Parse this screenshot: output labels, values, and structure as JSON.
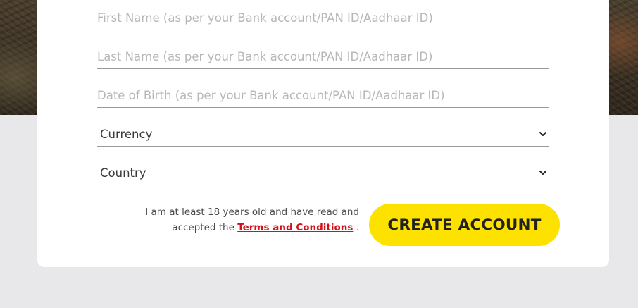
{
  "form": {
    "first_name_placeholder": "First Name (as per your Bank account/PAN ID/Aadhaar ID)",
    "last_name_placeholder": "Last Name (as per your Bank account/PAN ID/Aadhaar ID)",
    "dob_placeholder": "Date of Birth (as per your Bank account/PAN ID/Aadhaar ID)",
    "currency_label": "Currency",
    "country_label": "Country"
  },
  "terms": {
    "line1": "I am at least 18 years old and have read and",
    "prefix": "accepted the",
    "link_text": "Terms and Conditions",
    "suffix": "."
  },
  "actions": {
    "create_account_label": "CREATE ACCOUNT"
  },
  "colors": {
    "button_bg": "#fde200",
    "link": "#d4111b",
    "page_bg": "#e8e8ea"
  },
  "icons": {
    "dropdown": "chevron-down-icon"
  }
}
